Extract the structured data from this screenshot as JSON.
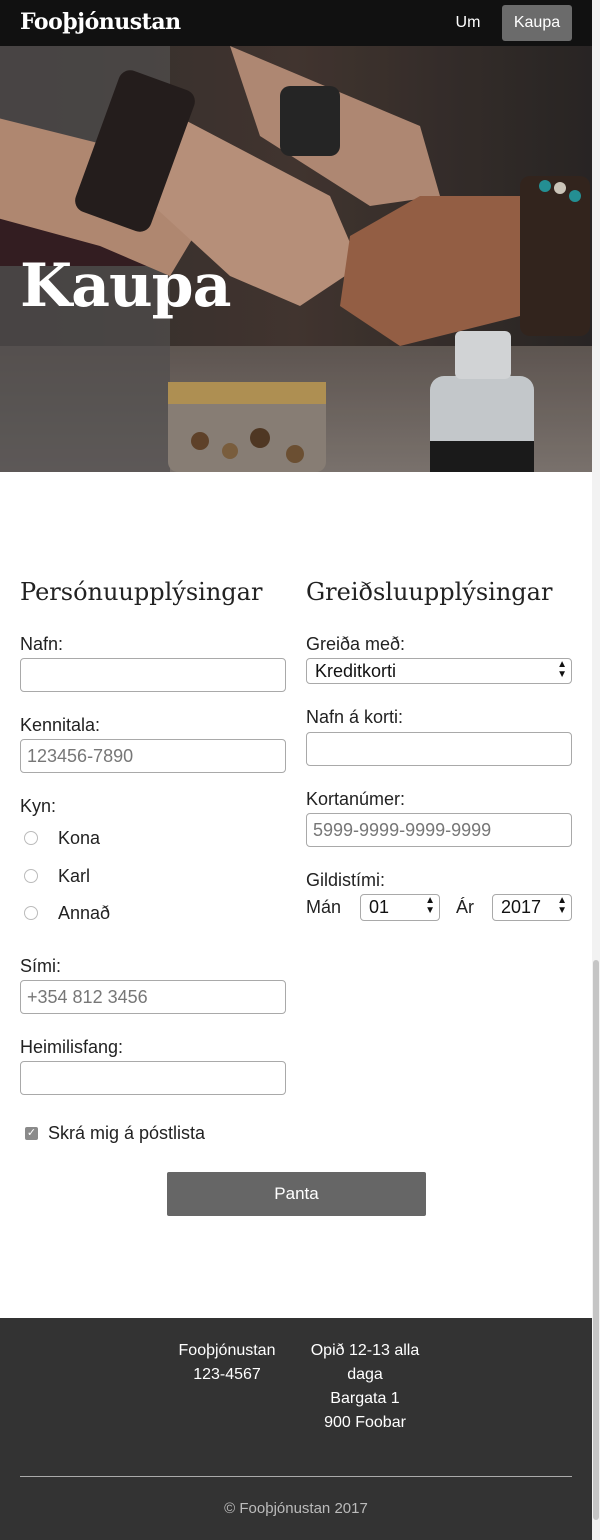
{
  "header": {
    "brand": "Fooþjónustan",
    "nav": {
      "um": "Um",
      "kaupa": "Kaupa"
    }
  },
  "hero": {
    "title": "Kaupa"
  },
  "personal": {
    "title": "Persónuupplýsingar",
    "name_label": "Nafn:",
    "name_value": "",
    "kennitala_label": "Kennitala:",
    "kennitala_placeholder": "123456-7890",
    "gender_label": "Kyn:",
    "gender_options": [
      "Kona",
      "Karl",
      "Annað"
    ],
    "phone_label": "Sími:",
    "phone_placeholder": "+354 812 3456",
    "address_label": "Heimilisfang:",
    "address_value": "",
    "newsletter_label": "Skrá mig á póstlista",
    "newsletter_checked": true
  },
  "payment": {
    "title": "Greiðsluupplýsingar",
    "method_label": "Greiða með:",
    "method_value": "Kreditkorti",
    "card_name_label": "Nafn á korti:",
    "card_number_label": "Kortanúmer:",
    "card_number_placeholder": "5999-9999-9999-9999",
    "expiry_label": "Gildistími:",
    "month_label": "Mán",
    "month_value": "01",
    "year_label": "Ár",
    "year_value": "2017"
  },
  "submit": {
    "label": "Panta"
  },
  "footer": {
    "company": "Fooþjónustan",
    "phone": "123-4567",
    "hours_line1": "Opið 12-13 alla",
    "hours_line2": "daga",
    "street": "Bargata 1",
    "city": "900 Foobar",
    "copyright": "© Fooþjónustan 2017"
  },
  "colors": {
    "navbar": "#111111",
    "active_nav": "#6b6b6b",
    "button": "#666666",
    "footer": "#333333"
  }
}
